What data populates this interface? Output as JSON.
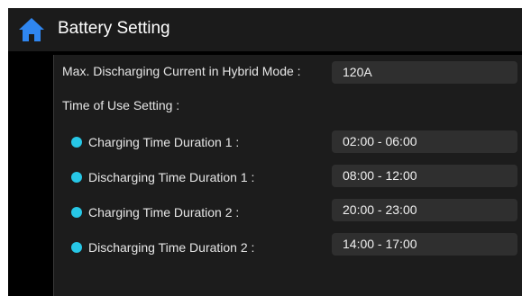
{
  "header": {
    "title": "Battery Setting",
    "home_icon": "home-icon",
    "home_icon_color": "#2f86f0"
  },
  "max_discharge": {
    "label": "Max. Discharging Current in Hybrid Mode :",
    "value": "120A"
  },
  "tou": {
    "section_label": "Time of Use Setting :",
    "bullet_color": "#27c7e6",
    "items": [
      {
        "label": "Charging Time Duration 1 :",
        "value": "02:00 - 06:00"
      },
      {
        "label": "Discharging Time Duration 1 :",
        "value": "08:00 - 12:00"
      },
      {
        "label": "Charging Time Duration 2 :",
        "value": "20:00 - 23:00"
      },
      {
        "label": "Discharging Time Duration 2 :",
        "value": "14:00 - 17:00"
      }
    ]
  }
}
